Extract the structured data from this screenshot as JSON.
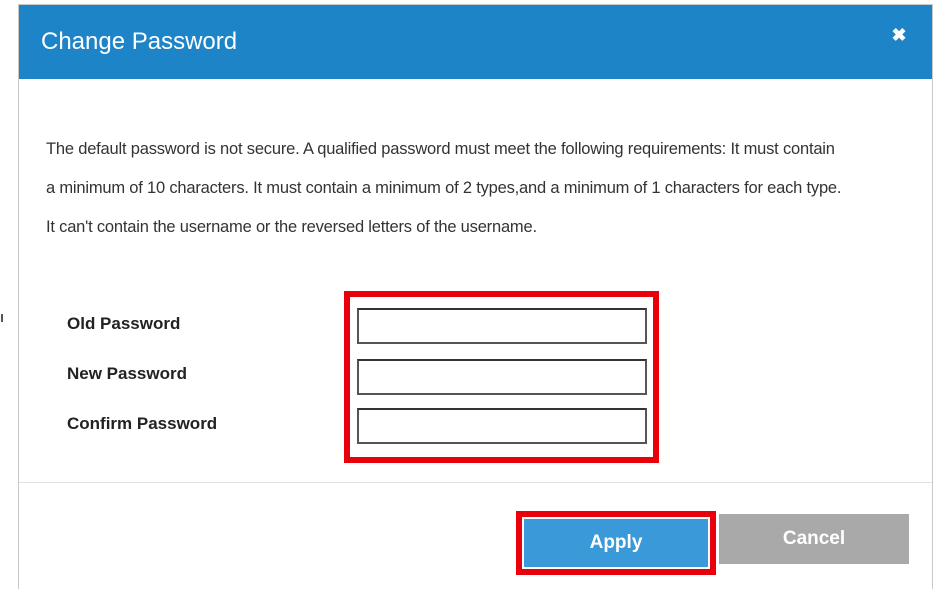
{
  "dialog": {
    "title": "Change Password",
    "close_icon": "close-icon",
    "description": "The default password is not secure. A qualified password must meet the following requirements: It must contain a minimum of 10 characters. It must contain a minimum of 2 types,and a minimum of 1 characters for each type. It can't contain the username or the reversed letters of the username.",
    "fields": {
      "old_password": {
        "label": "Old Password",
        "value": ""
      },
      "new_password": {
        "label": "New Password",
        "value": ""
      },
      "confirm_password": {
        "label": "Confirm Password",
        "value": ""
      }
    },
    "buttons": {
      "apply": "Apply",
      "cancel": "Cancel"
    }
  },
  "colors": {
    "title_bar": "#1e84c8",
    "apply_button": "#3a9ad9",
    "cancel_button": "#a9a9a9",
    "highlight": "#e8000b"
  }
}
